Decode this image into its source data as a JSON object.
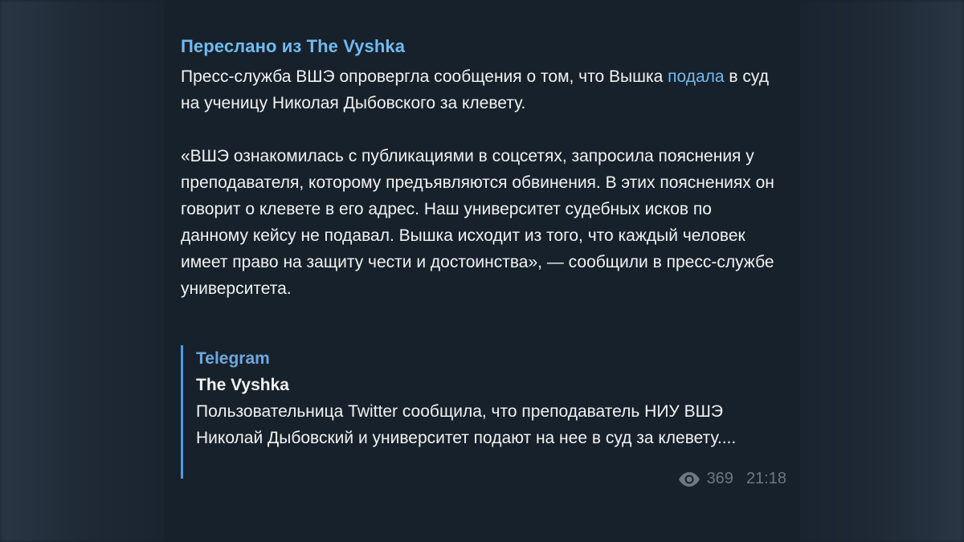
{
  "message": {
    "forwarded_from": "Переслано из The Vyshka",
    "paragraph1_part1": "Пресс-служба ВШЭ опровергла сообщения о том, что Вышка ",
    "paragraph1_link": "подала",
    "paragraph1_part2": " в суд на ученицу Николая Дыбовского за клевету.",
    "paragraph2": "«ВШЭ ознакомилась с публикациями в соцсетях, запросила пояснения у преподавателя, которому предъявляются обвинения. В этих пояснениях он говорит о клевете в его адрес. Наш университет судебных исков по данному кейсу не подавал. Вышка исходит из того, что каждый человек имеет право на защиту чести и достоинства», — сообщили в пресс-службе университета."
  },
  "preview": {
    "site": "Telegram",
    "title": "The Vyshka",
    "description": "Пользовательница Twitter сообщила, что преподаватель НИУ ВШЭ Николай Дыбовский и университет подают на нее в суд за клевету...."
  },
  "meta": {
    "views": "369",
    "time": "21:18",
    "views_icon": "eye-icon"
  },
  "colors": {
    "background": "#17212b",
    "link": "#71baf2",
    "preview_bar": "#4f9ce6",
    "meta_text": "#6d7883"
  }
}
